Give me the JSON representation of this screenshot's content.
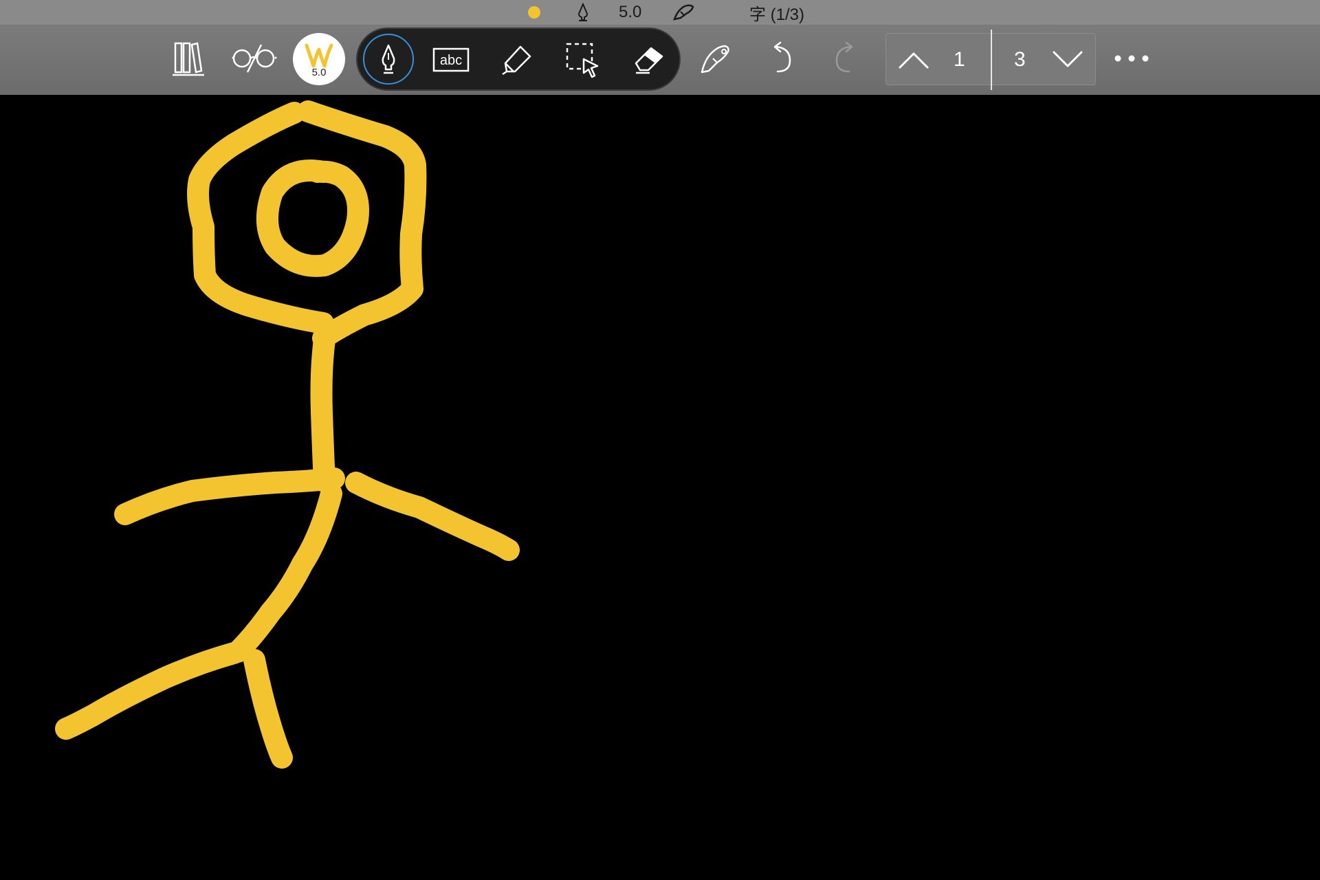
{
  "status": {
    "pen_color": "#f4c430",
    "pen_size": "5.0",
    "char_count": "字 (1/3)"
  },
  "toolbar": {
    "pen_size_label": "5.0",
    "tools": [
      "library-icon",
      "reading-glasses-icon",
      "pen-icon",
      "text-box-icon",
      "highlighter-icon",
      "lasso-select-icon",
      "eraser-icon",
      "hand-pen-icon",
      "undo-icon",
      "redo-icon"
    ]
  },
  "page_nav": {
    "current_page": "1",
    "total_pages": "3"
  },
  "canvas": {
    "background": "#000000",
    "ink_color": "#f4c430"
  }
}
